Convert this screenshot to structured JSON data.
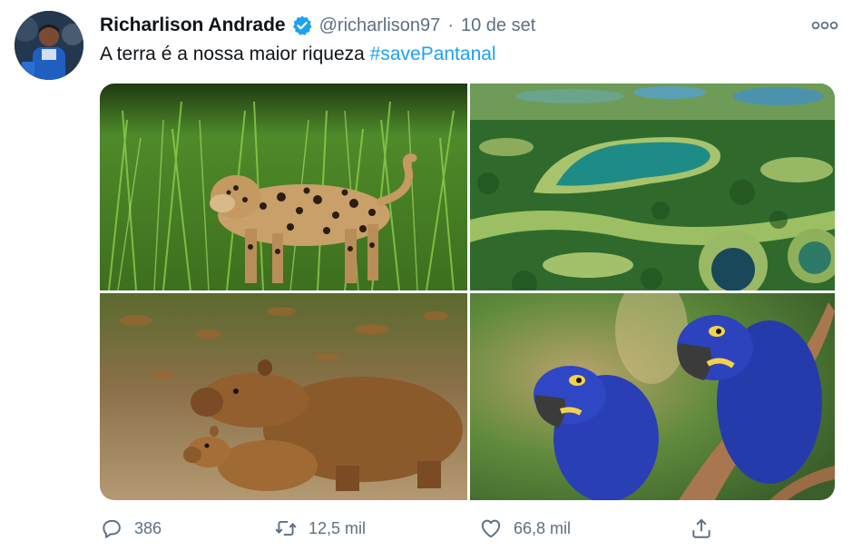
{
  "tweet": {
    "author": {
      "display_name": "Richarlison Andrade",
      "handle": "@richarlison97",
      "verified": true,
      "verified_icon": "verified-badge-icon",
      "verified_color": "#1da1f2"
    },
    "separator": "·",
    "date": "10 de set",
    "text_prefix": "A terra é a nossa maior riqueza ",
    "hashtag": "#savePantanal",
    "hashtag_color": "#1da1f2",
    "more_icon": "more-horizontal-icon",
    "media": [
      {
        "subject": "jaguar",
        "icon": "jaguar-photo"
      },
      {
        "subject": "pantanal-aerial",
        "icon": "wetland-aerial-photo"
      },
      {
        "subject": "capybaras",
        "icon": "capybara-photo"
      },
      {
        "subject": "hyacinth-macaws",
        "icon": "macaw-photo"
      }
    ],
    "actions": {
      "reply": {
        "icon": "reply-icon",
        "count": "386"
      },
      "retweet": {
        "icon": "retweet-icon",
        "count": "12,5 mil"
      },
      "like": {
        "icon": "heart-icon",
        "count": "66,8 mil"
      },
      "share": {
        "icon": "share-icon"
      }
    },
    "muted_color": "#5b7083"
  }
}
